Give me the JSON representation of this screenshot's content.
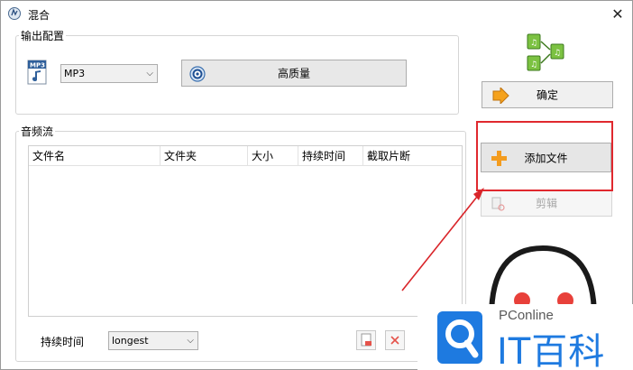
{
  "window": {
    "title": "混合",
    "close_glyph": "✕"
  },
  "output_config": {
    "group_label": "输出配置",
    "format_icon_label": "MP3",
    "format_select_value": "MP3",
    "quality_button_label": "高质量"
  },
  "audio_stream": {
    "group_label": "音频流",
    "columns": [
      "文件名",
      "文件夹",
      "大小",
      "持续时间",
      "截取片断"
    ],
    "duration_label": "持续时间",
    "duration_select_value": "longest"
  },
  "side": {
    "confirm_button_label": "确定",
    "add_file_button_label": "添加文件",
    "edit_button_label": "剪辑"
  },
  "watermark": {
    "brand_small": "PConline",
    "brand_large": "IT百科"
  },
  "colors": {
    "highlight_box": "#e0282e",
    "arrow": "#d9252a",
    "watermark_blue": "#1e7ae0"
  }
}
